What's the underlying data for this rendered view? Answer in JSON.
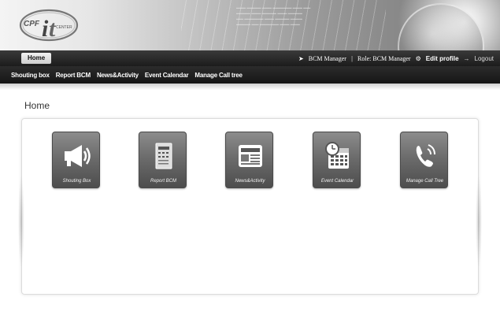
{
  "app": {
    "logo_text": "CPF",
    "logo_sub": "CENTER"
  },
  "topbar": {
    "home_tab": "Home",
    "user": "BCM Manager",
    "separator": "|",
    "role": "Role: BCM Manager",
    "edit_profile": "Edit profile",
    "logout": "Logout"
  },
  "menu": {
    "items": [
      {
        "label": "Shouting box"
      },
      {
        "label": "Report BCM"
      },
      {
        "label": "News&Activity"
      },
      {
        "label": "Event Calendar"
      },
      {
        "label": "Manage Call tree"
      }
    ]
  },
  "page": {
    "title": "Home"
  },
  "tiles": [
    {
      "label": "Shouting Box",
      "icon": "megaphone-icon"
    },
    {
      "label": "Report BCM",
      "icon": "report-icon"
    },
    {
      "label": "News&Activity",
      "icon": "newspaper-icon"
    },
    {
      "label": "Event Calendar",
      "icon": "calendar-icon"
    },
    {
      "label": "Manage Call Tree",
      "icon": "phone-icon"
    }
  ],
  "colors": {
    "bar_dark": "#1c1c1c",
    "tile_top": "#8c8c8c",
    "tile_bottom": "#4d4d4d"
  }
}
